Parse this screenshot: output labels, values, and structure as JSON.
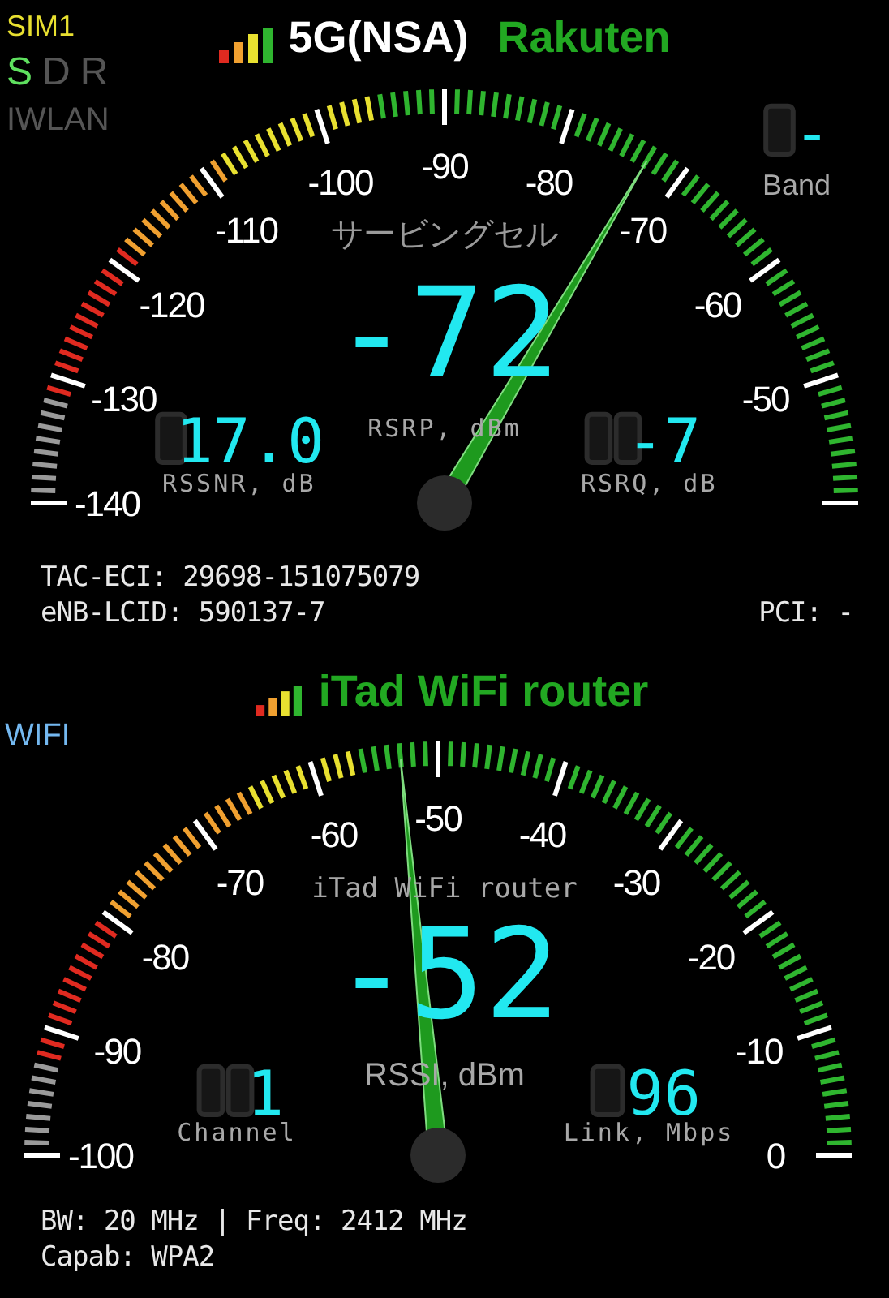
{
  "sim": {
    "label": "SIM1",
    "modes": [
      {
        "label": "S",
        "selected": true
      },
      {
        "label": "D",
        "selected": false
      },
      {
        "label": "R",
        "selected": false
      }
    ],
    "iwlan": "IWLAN"
  },
  "cell": {
    "network": "5G(NSA)",
    "operator": "Rakuten",
    "band_label": "Band",
    "band": "-",
    "scale_labels": [
      "-140",
      "-130",
      "-120",
      "-110",
      "-100",
      "-90",
      "-80",
      "-70",
      "-60",
      "-50"
    ],
    "caption": "サービングセル",
    "rsrp": "-72",
    "rsrp_label": "RSRP, dBm",
    "rssnr": "17.0",
    "rssnr_label": "RSSNR, dB",
    "rsrq": "-7",
    "rsrq_label": "RSRQ, dB",
    "tac_eci": "TAC-ECI: 29698-151075079",
    "enb_lcid": "eNB-LCID: 590137-7",
    "pci": "PCI: -"
  },
  "wifi": {
    "label": "WIFI",
    "ssid_title": "iTad WiFi router",
    "scale_labels": [
      "-100",
      "-90",
      "-80",
      "-70",
      "-60",
      "-50",
      "-40",
      "-30",
      "-20",
      "-10",
      "0"
    ],
    "caption": "iTad WiFi router",
    "rssi": "-52",
    "rssi_label": "RSSI, dBm",
    "channel": "1",
    "channel_label": "Channel",
    "link": "96",
    "link_label": "Link, Mbps",
    "bw_freq": "BW: 20 MHz | Freq: 2412 MHz",
    "capab": "Capab: WPA2"
  }
}
